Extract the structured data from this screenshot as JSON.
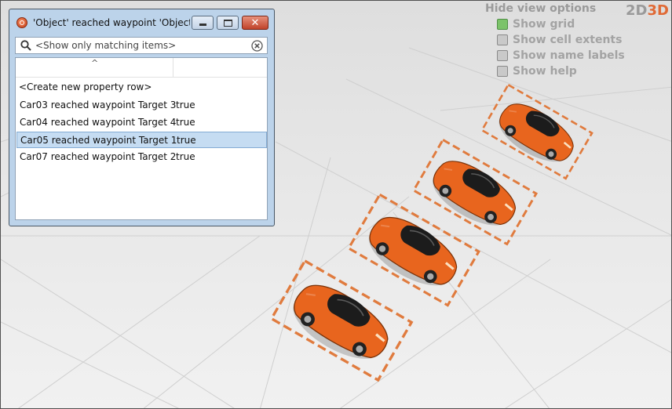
{
  "window": {
    "title": "'Object' reached waypoint 'Object' ...",
    "minimize_label": "",
    "maximize_label": "",
    "close_label": "✕"
  },
  "search": {
    "placeholder": "<Show only matching items>",
    "value": ""
  },
  "property_list": {
    "sort_indicator": "^",
    "create_row_label": "<Create new property row>",
    "rows": [
      {
        "name": "Car03 reached waypoint Target 3",
        "value": "true",
        "selected": false
      },
      {
        "name": "Car04 reached waypoint Target 4",
        "value": "true",
        "selected": false
      },
      {
        "name": "Car05 reached waypoint Target 1",
        "value": "true",
        "selected": true
      },
      {
        "name": "Car07 reached waypoint Target 2",
        "value": "true",
        "selected": false
      }
    ]
  },
  "view_options": {
    "toggle_label": "Hide view options",
    "items": [
      {
        "label": "Show grid",
        "checked": true
      },
      {
        "label": "Show cell extents",
        "checked": false
      },
      {
        "label": "Show name labels",
        "checked": false
      },
      {
        "label": "Show help",
        "checked": false
      }
    ]
  },
  "view_mode": {
    "label_2d": "2D",
    "label_3d": "3D",
    "active": "3D"
  },
  "scene": {
    "car_color": "#e8651e",
    "target_outline_color": "#e07b3e",
    "car_count": 4
  }
}
